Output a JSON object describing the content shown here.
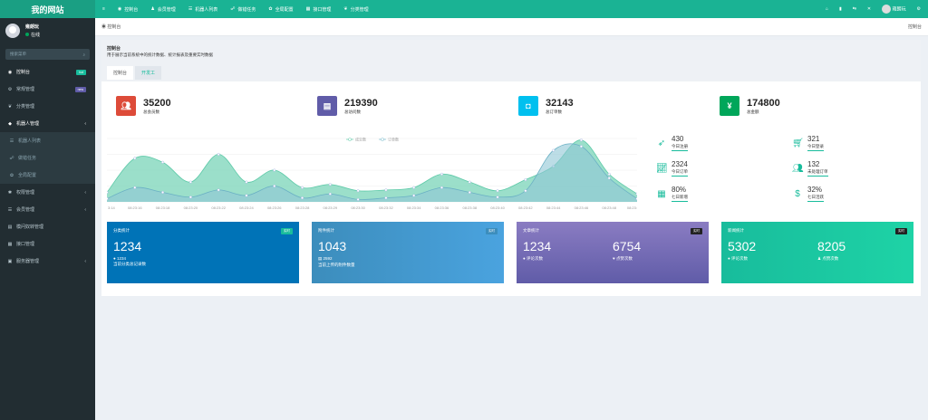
{
  "app": {
    "logo": "我的网站"
  },
  "user": {
    "name": "雍朗玩",
    "status": "在线"
  },
  "sidebar": {
    "search_placeholder": "搜索菜单",
    "items": [
      {
        "label": "控制台",
        "icon": "dashboard-icon",
        "badge": "hot",
        "badge_color": "#18bc9c",
        "active": true
      },
      {
        "label": "常规管理",
        "icon": "cogs-icon",
        "badge": "new",
        "badge_color": "#605ca8"
      },
      {
        "label": "分类管理",
        "icon": "leaf-icon"
      },
      {
        "label": "机器人管理",
        "icon": "diamond-icon",
        "arrow": true
      },
      {
        "label": "机器人列表",
        "icon": "list-icon",
        "sub": true
      },
      {
        "label": "做错任务",
        "icon": "sitemap-icon",
        "sub": true
      },
      {
        "label": "全局配置",
        "icon": "gear-icon",
        "sub": true
      },
      {
        "label": "权限管理",
        "icon": "group-icon",
        "arrow": true
      },
      {
        "label": "会员管理",
        "icon": "list-icon",
        "arrow": true
      },
      {
        "label": "模问奴转管理",
        "icon": "book-icon"
      },
      {
        "label": "接口管理",
        "icon": "table-icon"
      },
      {
        "label": "服务器管理",
        "icon": "server-icon",
        "arrow": true
      }
    ]
  },
  "topnav": {
    "items": [
      {
        "label": "控制台",
        "icon": "dashboard-icon"
      },
      {
        "label": "会员管理",
        "icon": "user-icon"
      },
      {
        "label": "机器人列表",
        "icon": "list-icon"
      },
      {
        "label": "做错任务",
        "icon": "sitemap-icon"
      },
      {
        "label": "全局配置",
        "icon": "gear-icon"
      },
      {
        "label": "接口管理",
        "icon": "table-icon"
      },
      {
        "label": "分类管理",
        "icon": "leaf-icon"
      }
    ],
    "right_user": "雍朗玩"
  },
  "breadcrumb": {
    "home": "控制台",
    "right": "控制台"
  },
  "panel": {
    "title": "控制台",
    "desc": "用于展示当前系统中的统计数据、统计报表及重要实时数据",
    "tabs": [
      "控制台",
      "开发工"
    ]
  },
  "stats": [
    {
      "value": "35200",
      "label": "总会员数",
      "color": "#dd4b39",
      "icon": "users-icon"
    },
    {
      "value": "219390",
      "label": "总访问数",
      "color": "#605ca8",
      "icon": "book-icon"
    },
    {
      "value": "32143",
      "label": "总订单数",
      "color": "#00c0ef",
      "icon": "bag-icon"
    },
    {
      "value": "174800",
      "label": "总金额",
      "color": "#00a65a",
      "icon": "yen-icon"
    }
  ],
  "chart_data": {
    "type": "area",
    "legend": [
      "成交数",
      "订单数"
    ],
    "legend_position": "top-center",
    "categories": [
      "3:14",
      "08:23:16",
      "08:23:18",
      "08:23:20",
      "08:23:22",
      "08:23:24",
      "08:23:26",
      "08:23:28",
      "08:23:29",
      "08:23:30",
      "08:23:32",
      "08:23:34",
      "08:23:36",
      "08:23:38",
      "08:23:40",
      "08:23:42",
      "08:23:44",
      "08:23:46",
      "08:23:48",
      "08:23:"
    ],
    "series": [
      {
        "name": "成交数",
        "values": [
          12,
          55,
          50,
          25,
          60,
          25,
          40,
          18,
          22,
          14,
          15,
          18,
          35,
          25,
          14,
          28,
          45,
          78,
          35,
          10
        ],
        "color": "#7ad4b8"
      },
      {
        "name": "订单数",
        "values": [
          4,
          18,
          12,
          6,
          15,
          8,
          20,
          5,
          10,
          3,
          5,
          8,
          18,
          12,
          6,
          14,
          65,
          70,
          30,
          4
        ],
        "color": "#8fc7d6"
      }
    ],
    "ylim": [
      0,
      80
    ],
    "grid": true
  },
  "side_stats": [
    {
      "value": "430",
      "label": "今日注册",
      "icon": "rocket-icon"
    },
    {
      "value": "321",
      "label": "今日登录",
      "icon": "cart-icon"
    },
    {
      "value": "2324",
      "label": "今日订单",
      "icon": "area-chart-icon"
    },
    {
      "value": "132",
      "label": "未处理订单",
      "icon": "users-icon"
    },
    {
      "value": "80%",
      "label": "七日新增",
      "icon": "calendar-icon"
    },
    {
      "value": "32%",
      "label": "七日活跃",
      "icon": "dollar-icon"
    }
  ],
  "cards": [
    {
      "title": "分类统计",
      "badge": "实时",
      "badge_color": "#18bc9c",
      "value": "1234",
      "sub": "1234",
      "sub_icon": "comment-icon",
      "label": "当前分类总记录数",
      "color": "#0073b7"
    },
    {
      "title": "附件统计",
      "badge": "实时",
      "badge_color": "#3c8dbc",
      "value": "1043",
      "sub": "2592",
      "sub_icon": "files-icon",
      "label": "当前上传的附件数量",
      "color": "#3498db"
    },
    {
      "title": "文章统计",
      "badge": "实时",
      "badge_color": "#222",
      "value": "1234",
      "value2": "6754",
      "sub": "评论次数",
      "sub2": "点赞次数",
      "color": "#605ca8"
    },
    {
      "title": "新闻统计",
      "badge": "实时",
      "badge_color": "#222",
      "value": "5302",
      "value2": "8205",
      "sub": "评论次数",
      "sub2": "点赞次数",
      "color": "#18bc9c"
    }
  ]
}
